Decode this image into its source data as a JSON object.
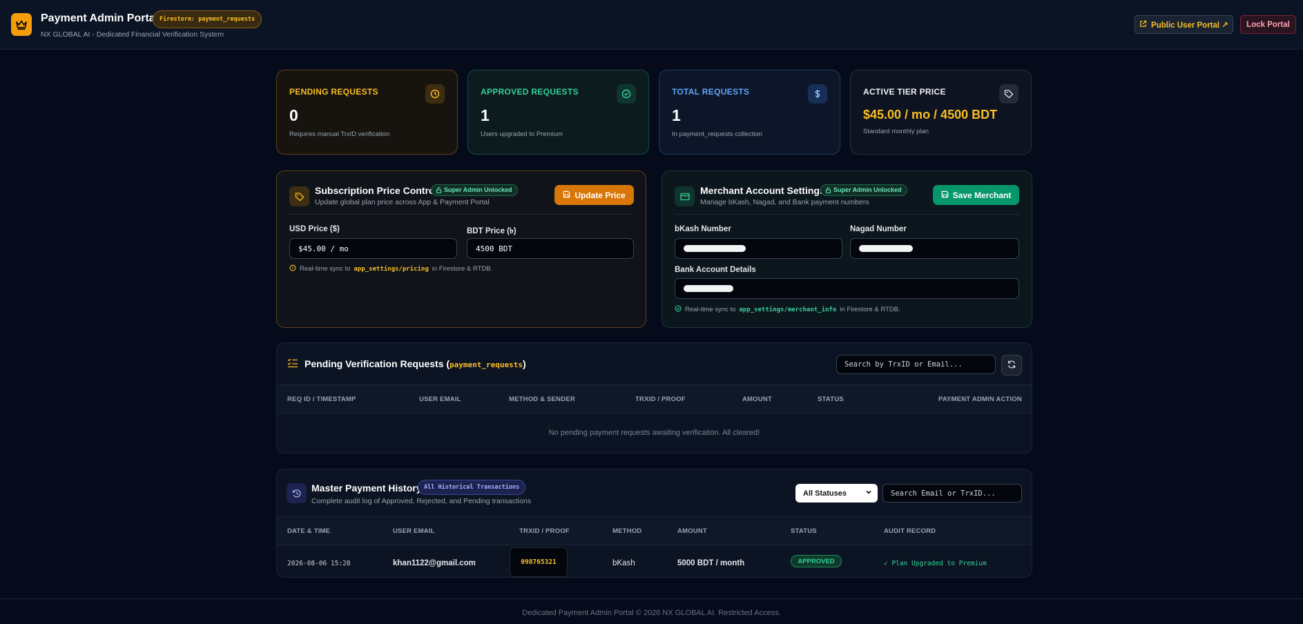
{
  "header": {
    "title": "Payment Admin Portal",
    "badge": "Firestore: payment_requests",
    "subtitle": "NX GLOBAL AI - Dedicated Financial Verification System",
    "public_portal_label": "Public User Portal ↗",
    "lock_label": "Lock Portal"
  },
  "stats": [
    {
      "label": "PENDING REQUESTS",
      "value": "0",
      "note": "Requires manual TrxID verification",
      "icon": "clock-icon"
    },
    {
      "label": "APPROVED REQUESTS",
      "value": "1",
      "note": "Users upgraded to Premium",
      "icon": "check-circle-icon"
    },
    {
      "label": "TOTAL REQUESTS",
      "value": "1",
      "note": "In payment_requests collection",
      "icon": "dollar-icon"
    },
    {
      "label": "ACTIVE TIER PRICE",
      "value": "$45.00 / mo / 4500 BDT",
      "note": "Standard monthly plan",
      "icon": "tag-icon"
    }
  ],
  "price_control": {
    "title": "Subscription Price Control",
    "badge": "Super Admin Unlocked",
    "subtitle": "Update global plan price across App & Payment Portal",
    "button": "Update Price",
    "usd_label": "USD Price ($)",
    "usd_value": "$45.00 / mo",
    "bdt_label": "BDT Price (৳)",
    "bdt_value": "4500 BDT",
    "sync_prefix": "Real-time sync to",
    "sync_path": "app_settings/pricing",
    "sync_suffix": "in Firestore & RTDB."
  },
  "merchant": {
    "title": "Merchant Account Settings",
    "badge": "Super Admin Unlocked",
    "subtitle": "Manage bKash, Nagad, and Bank payment numbers",
    "button": "Save Merchant",
    "bkash_label": "bKash Number",
    "nagad_label": "Nagad Number",
    "bank_label": "Bank Account Details",
    "sync_prefix": "Real-time sync to",
    "sync_path": "app_settings/merchant_info",
    "sync_suffix": "in Firestore & RTDB."
  },
  "pending": {
    "title": "Pending Verification Requests (",
    "title_code": "payment_requests",
    "title_close": ")",
    "search_placeholder": "Search by TrxID or Email...",
    "columns": [
      "REQ ID / TIMESTAMP",
      "USER EMAIL",
      "METHOD & SENDER",
      "TRXID / PROOF",
      "AMOUNT",
      "STATUS",
      "PAYMENT ADMIN ACTION"
    ],
    "empty_text": "No pending payment requests awaiting verification. All cleared!"
  },
  "history": {
    "title": "Master Payment History",
    "badge": "All Historical Transactions",
    "subtitle": "Complete audit log of Approved, Rejected, and Pending transactions",
    "filter_value": "All Statuses",
    "search_placeholder": "Search Email or TrxID...",
    "columns": [
      "DATE & TIME",
      "USER EMAIL",
      "TRXID / PROOF",
      "METHOD",
      "AMOUNT",
      "STATUS",
      "AUDIT RECORD"
    ],
    "rows": [
      {
        "date": "2026-08-06 15:28",
        "email": "khan1122@gmail.com",
        "trxid": "098765321",
        "method": "bKash",
        "amount": "5000 BDT / month",
        "status": "APPROVED",
        "audit": "✓ Plan Upgraded to Premium"
      }
    ]
  },
  "footer": "Dedicated Payment Admin Portal © 2026 NX GLOBAL AI. Restricted Access.",
  "colors": {
    "accent": "#f59e0b",
    "success": "#34d399",
    "info": "#60a5fa",
    "background": "#050b1a"
  }
}
